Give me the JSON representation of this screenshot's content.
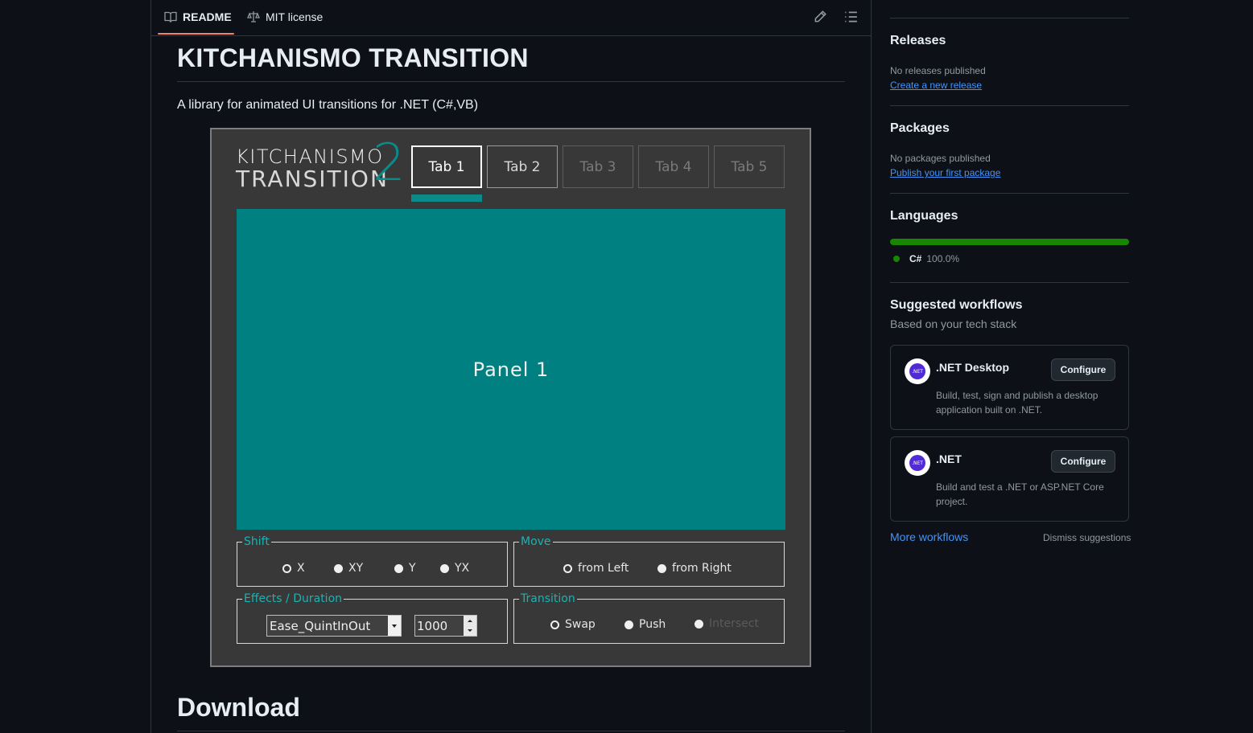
{
  "readme_tabs": {
    "readme_label": "README",
    "license_label": "MIT license"
  },
  "article": {
    "title": "KITCHANISMO TRANSITION",
    "description": "A library for animated UI transitions for .NET (C#,VB)",
    "download_heading": "Download"
  },
  "demo_app": {
    "logo_line1": "KITCHANISMO",
    "logo_line2": "TRANSITION",
    "logo_number": "2",
    "tabs": [
      "Tab 1",
      "Tab 2",
      "Tab 3",
      "Tab 4",
      "Tab 5"
    ],
    "panel_label": "Panel 1",
    "shift": {
      "label": "Shift",
      "options": [
        "X",
        "XY",
        "Y",
        "YX"
      ]
    },
    "move": {
      "label": "Move",
      "options": [
        "from Left",
        "from Right"
      ]
    },
    "effects": {
      "label": "Effects / Duration",
      "easing_value": "Ease_QuintInOut",
      "duration_value": "1000"
    },
    "transition": {
      "label": "Transition",
      "options": [
        "Swap",
        "Push",
        "Intersect"
      ]
    },
    "accent_color": "#008080"
  },
  "sidebar": {
    "releases": {
      "heading": "Releases",
      "status": "No releases published",
      "link": "Create a new release"
    },
    "packages": {
      "heading": "Packages",
      "status": "No packages published",
      "link": "Publish your first package"
    },
    "languages": {
      "heading": "Languages",
      "items": [
        {
          "name": "C#",
          "percent": "100.0%",
          "color": "#178600"
        }
      ]
    },
    "workflows": {
      "heading": "Suggested workflows",
      "subheading": "Based on your tech stack",
      "cards": [
        {
          "title": ".NET Desktop",
          "button": "Configure",
          "description": "Build, test, sign and publish a desktop application built on .NET.",
          "avatar_text": ".NET"
        },
        {
          "title": ".NET",
          "button": "Configure",
          "description": "Build and test a .NET or ASP.NET Core project.",
          "avatar_text": ".NET"
        }
      ],
      "more_link": "More workflows",
      "dismiss_link": "Dismiss suggestions"
    }
  }
}
